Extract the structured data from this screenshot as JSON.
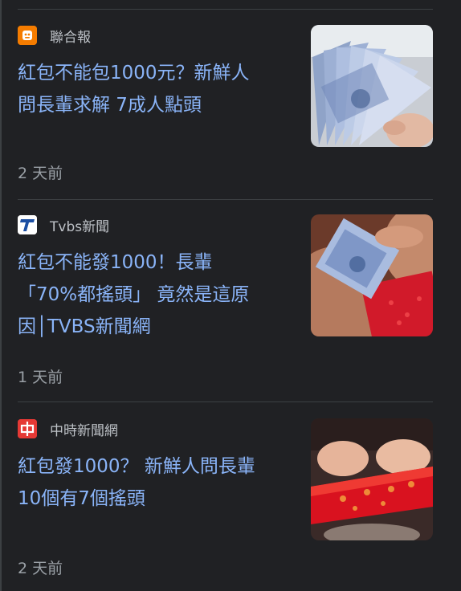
{
  "articles": [
    {
      "source": "聯合報",
      "source_icon": "udn-logo-icon",
      "source_color": "#f57c00",
      "headline": "紅包不能包1000元？新鮮人\n問長輩求解 7成人點頭",
      "time": "2 天前",
      "thumbnail": "banknotes-fan-thumbnail"
    },
    {
      "source": "Tvbs新聞",
      "source_icon": "tvbs-logo-icon",
      "source_color": "#ffffff",
      "headline": "紅包不能發1000！長輩\n「70%都搖頭」 竟然是這原\n因│TVBS新聞網",
      "time": "1 天前",
      "thumbnail": "banknotes-red-envelope-thumbnail"
    },
    {
      "source": "中時新聞網",
      "source_icon": "chinatimes-logo-icon",
      "source_color": "#e53935",
      "headline": "紅包發1000？ 新鮮人問長輩\n10個有7個搖頭",
      "time": "2 天前",
      "thumbnail": "red-envelope-hands-thumbnail"
    }
  ],
  "colors": {
    "background": "#202124",
    "headline": "#8ab4f8",
    "meta": "#9aa0a6",
    "divider": "#3c4043"
  }
}
